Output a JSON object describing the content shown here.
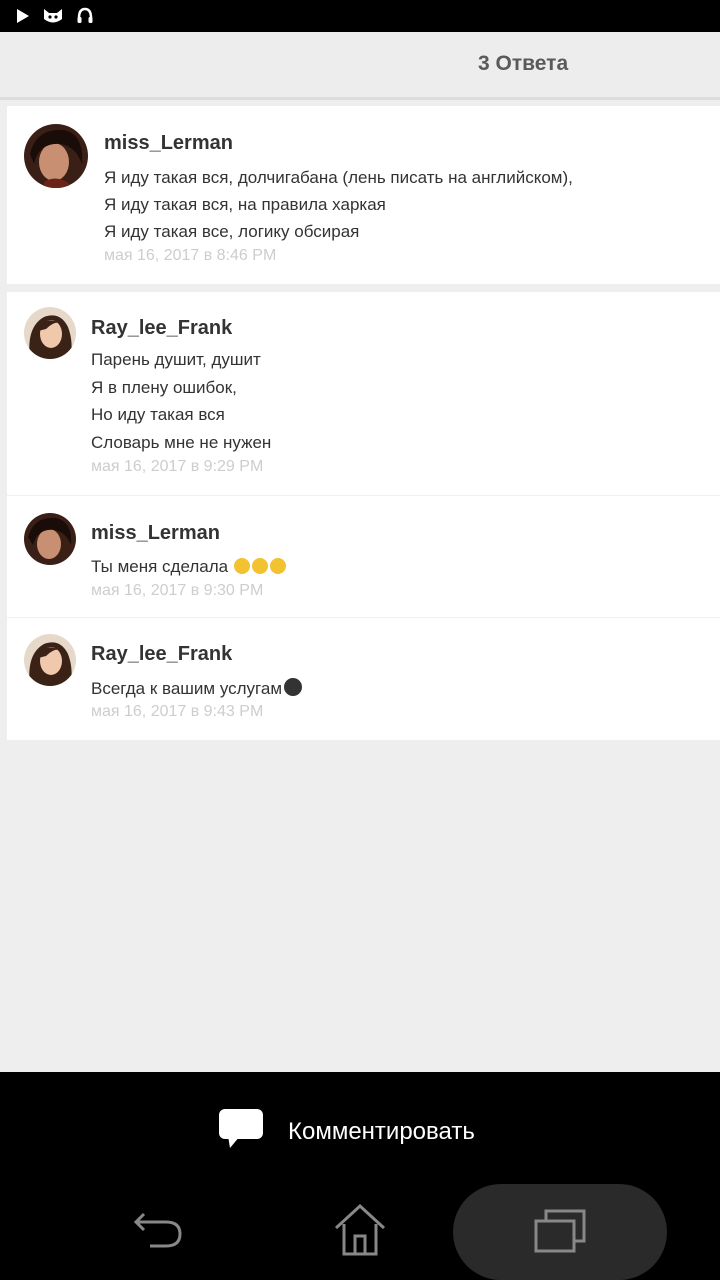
{
  "status_bar": {
    "icons": [
      "play-icon",
      "cat-icon",
      "headset-icon"
    ]
  },
  "header": {
    "title": "3 Ответа"
  },
  "main_comment": {
    "username": "miss_Lerman",
    "lines": [
      "Я иду такая вся, долчигабана (лень писать на английском),",
      "Я иду такая вся, на правила харкая",
      "Я иду такая все, логику обсирая"
    ],
    "timestamp": "мая 16, 2017 в 8:46 PM"
  },
  "replies": [
    {
      "username": "Ray_lee_Frank",
      "lines": [
        "Парень душит, душит",
        "Я в плену ошибок,",
        "Но иду такая вся",
        "Словарь мне не нужен"
      ],
      "timestamp": "мая 16, 2017 в 9:29 PM"
    },
    {
      "username": "miss_Lerman",
      "lines": [
        "Ты меня сделала"
      ],
      "timestamp": "мая 16, 2017 в 9:30 PM"
    },
    {
      "username": "Ray_lee_Frank",
      "lines": [
        "Всегда к вашим услугам"
      ],
      "timestamp": "мая 16, 2017 в 9:43 PM"
    }
  ],
  "bottom_bar": {
    "comment_label": "Комментировать"
  },
  "nav": {
    "icons": [
      "back-icon",
      "home-icon",
      "recent-apps-icon"
    ]
  },
  "colors": {
    "background": "#eeeeee",
    "card": "#ffffff",
    "timestamp": "#cdcdcd",
    "bottom_bar": "#000000"
  }
}
